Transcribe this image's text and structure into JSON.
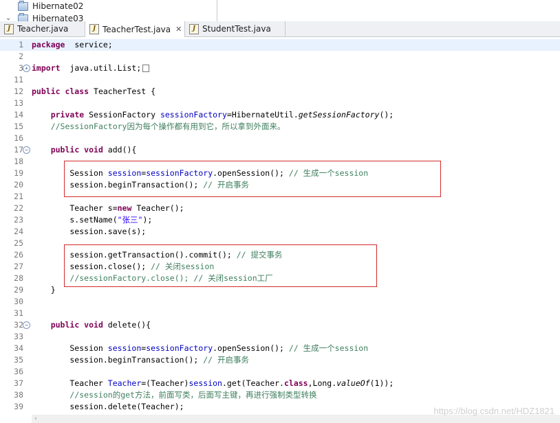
{
  "explorer": {
    "items": [
      "Hibernate02",
      "Hibernate03"
    ]
  },
  "tabs": [
    {
      "label": "Teacher.java",
      "active": false
    },
    {
      "label": "TeacherTest.java",
      "active": true,
      "closable": true
    },
    {
      "label": "StudentTest.java",
      "active": false
    }
  ],
  "editor": {
    "lines": [
      {
        "num": "1",
        "segs": [
          [
            "kw",
            "package"
          ],
          [
            "",
            "  service;"
          ]
        ]
      },
      {
        "num": "2",
        "segs": []
      },
      {
        "num": "3",
        "fold": "+",
        "segs": [
          [
            "kw",
            "import"
          ],
          [
            "",
            "  java.util.List;"
          ]
        ]
      },
      {
        "num": "11",
        "segs": []
      },
      {
        "num": "12",
        "segs": [
          [
            "kw",
            "public class"
          ],
          [
            "",
            " TeacherTest {"
          ]
        ]
      },
      {
        "num": "13",
        "segs": []
      },
      {
        "num": "14",
        "segs": [
          [
            "",
            "    "
          ],
          [
            "kw",
            "private"
          ],
          [
            "",
            " SessionFactory "
          ],
          [
            "fld",
            "sessionFactory"
          ],
          [
            "",
            "=HibernateUtil."
          ],
          [
            "it",
            "getSessionFactory"
          ],
          [
            "",
            "();"
          ]
        ]
      },
      {
        "num": "15",
        "segs": [
          [
            "",
            "    "
          ],
          [
            "cm",
            "//SessionFactory因为每个操作都有用到它，所以拿到外面来。"
          ]
        ]
      },
      {
        "num": "16",
        "segs": []
      },
      {
        "num": "17",
        "fold": "−",
        "segs": [
          [
            "",
            "    "
          ],
          [
            "kw",
            "public void"
          ],
          [
            "",
            " add(){"
          ]
        ]
      },
      {
        "num": "18",
        "segs": []
      },
      {
        "num": "19",
        "segs": [
          [
            "",
            "        Session "
          ],
          [
            "fld",
            "session"
          ],
          [
            "",
            "="
          ],
          [
            "fld",
            "sessionFactory"
          ],
          [
            "",
            ".openSession(); "
          ],
          [
            "cm",
            "// 生成一个session"
          ]
        ]
      },
      {
        "num": "20",
        "segs": [
          [
            "",
            "        session.beginTransaction(); "
          ],
          [
            "cm",
            "// 开启事务"
          ]
        ]
      },
      {
        "num": "21",
        "segs": []
      },
      {
        "num": "22",
        "segs": [
          [
            "",
            "        Teacher s="
          ],
          [
            "kw",
            "new"
          ],
          [
            "",
            " Teacher();"
          ]
        ]
      },
      {
        "num": "23",
        "segs": [
          [
            "",
            "        s.setName("
          ],
          [
            "str",
            "\"张三\""
          ],
          [
            "",
            ");"
          ]
        ]
      },
      {
        "num": "24",
        "segs": [
          [
            "",
            "        session.save(s);"
          ]
        ]
      },
      {
        "num": "25",
        "segs": []
      },
      {
        "num": "26",
        "segs": [
          [
            "",
            "        session.getTransaction().commit(); "
          ],
          [
            "cm",
            "// 提交事务"
          ]
        ]
      },
      {
        "num": "27",
        "segs": [
          [
            "",
            "        session.close(); "
          ],
          [
            "cm",
            "// 关闭session"
          ]
        ]
      },
      {
        "num": "28",
        "segs": [
          [
            "",
            "        "
          ],
          [
            "cm",
            "//sessionFactory.close(); // 关闭session工厂"
          ]
        ]
      },
      {
        "num": "29",
        "segs": [
          [
            "",
            "    }"
          ]
        ]
      },
      {
        "num": "30",
        "segs": []
      },
      {
        "num": "31",
        "segs": []
      },
      {
        "num": "32",
        "fold": "−",
        "segs": [
          [
            "",
            "    "
          ],
          [
            "kw",
            "public void"
          ],
          [
            "",
            " delete(){"
          ]
        ]
      },
      {
        "num": "33",
        "segs": []
      },
      {
        "num": "34",
        "segs": [
          [
            "",
            "        Session "
          ],
          [
            "fld",
            "session"
          ],
          [
            "",
            "="
          ],
          [
            "fld",
            "sessionFactory"
          ],
          [
            "",
            ".openSession(); "
          ],
          [
            "cm",
            "// 生成一个session"
          ]
        ]
      },
      {
        "num": "35",
        "segs": [
          [
            "",
            "        session.beginTransaction(); "
          ],
          [
            "cm",
            "// 开启事务"
          ]
        ]
      },
      {
        "num": "36",
        "segs": []
      },
      {
        "num": "37",
        "segs": [
          [
            "",
            "        Teacher "
          ],
          [
            "fld",
            "Teacher"
          ],
          [
            "",
            "=(Teacher)"
          ],
          [
            "fld",
            "session"
          ],
          [
            "",
            ".get(Teacher."
          ],
          [
            "kw",
            "class"
          ],
          [
            "",
            ",Long."
          ],
          [
            "it",
            "valueOf"
          ],
          [
            "",
            "(1));"
          ]
        ]
      },
      {
        "num": "38",
        "segs": [
          [
            "",
            "        "
          ],
          [
            "cm",
            "//session的get方法，前面写类，后面写主键，再进行强制类型转换"
          ]
        ]
      },
      {
        "num": "39",
        "segs": [
          [
            "",
            "        session.delete(Teacher);"
          ]
        ]
      }
    ]
  },
  "watermark": "https://blog.csdn.net/HDZ1821",
  "colors": {
    "keyword": "#7f0055",
    "field": "#0000c0",
    "comment": "#3f7f5f",
    "string": "#2a00ff",
    "highlight_box": "#d12a2a",
    "current_line": "#e8f2fe"
  }
}
